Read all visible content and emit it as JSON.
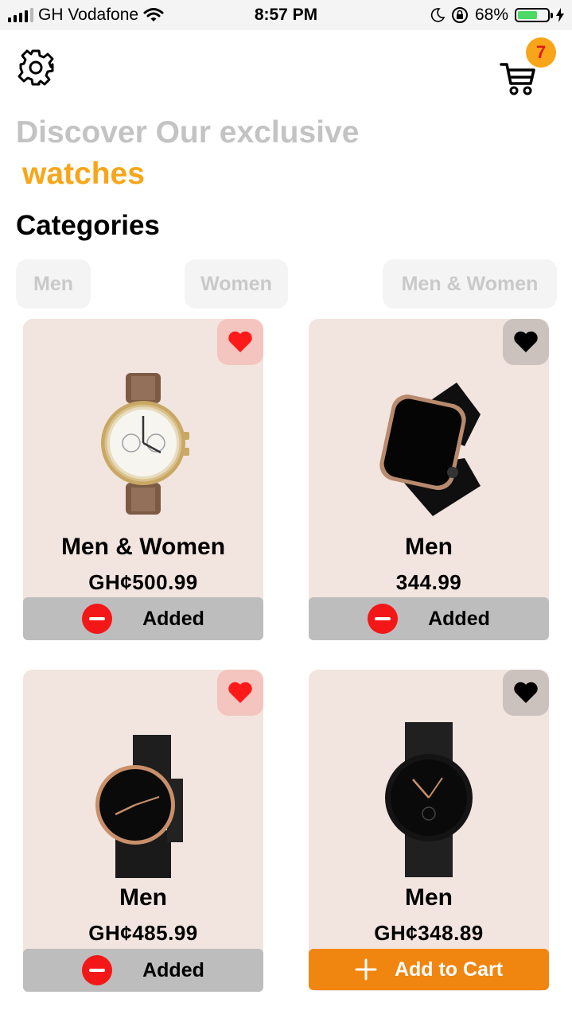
{
  "status_bar": {
    "carrier": "GH Vodafone",
    "time": "8:57 PM",
    "battery_percent": "68%",
    "battery_level": 0.68
  },
  "header": {
    "settings_icon": "gear-icon",
    "cart_icon": "cart-icon",
    "cart_count": "7"
  },
  "hero": {
    "line1": "Discover Our exclusive",
    "line2": "watches"
  },
  "categories": {
    "title": "Categories",
    "items": [
      "Men",
      "Women",
      "Men & Women"
    ]
  },
  "products": [
    {
      "title": "Men & Women",
      "price": "GH¢500.99",
      "favorite": true,
      "action_label": "Added",
      "in_cart": true
    },
    {
      "title": "Men",
      "price": "344.99",
      "favorite": false,
      "action_label": "Added",
      "in_cart": true
    },
    {
      "title": "Men",
      "price": "GH¢485.99",
      "favorite": true,
      "action_label": "Added",
      "in_cart": true
    },
    {
      "title": "Men",
      "price": "GH¢348.89",
      "favorite": false,
      "action_label": "Add to Cart",
      "in_cart": false
    }
  ],
  "colors": {
    "accent": "#f9a51a",
    "add_button": "#f0850f",
    "remove_icon": "#f41717",
    "card_bg": "#f2e4de",
    "favorite_on": "#ff1a1a"
  }
}
